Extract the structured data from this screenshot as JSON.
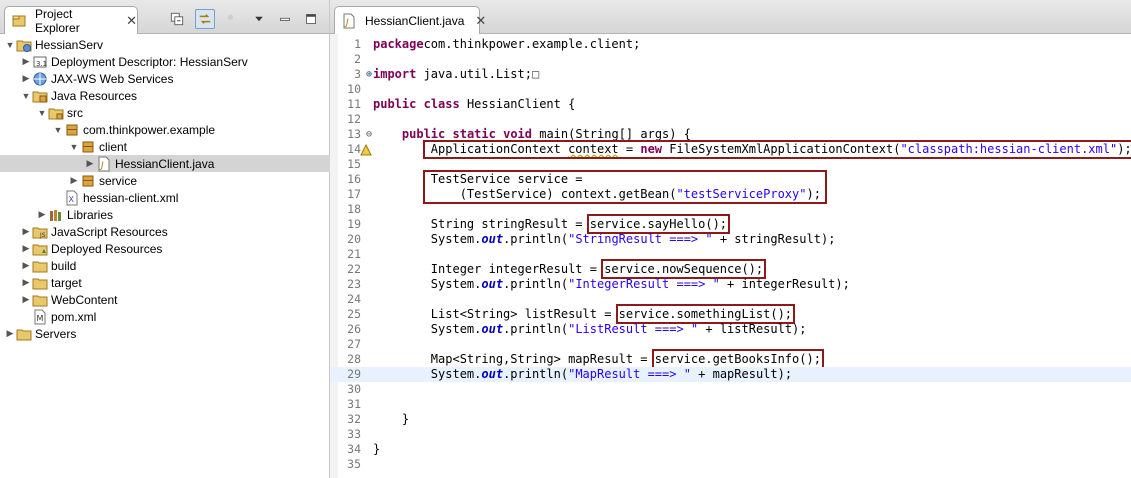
{
  "explorer": {
    "tab_label": "Project Explorer",
    "tab_close": "✕",
    "tree": [
      {
        "label": "HessianServ",
        "depth": 0,
        "twisty": "open",
        "icon": "web-project-icon"
      },
      {
        "label": "Deployment Descriptor: HessianServ",
        "depth": 1,
        "twisty": "closed",
        "icon": "deployment-descriptor-icon"
      },
      {
        "label": "JAX-WS Web Services",
        "depth": 1,
        "twisty": "closed",
        "icon": "web-services-icon"
      },
      {
        "label": "Java Resources",
        "depth": 1,
        "twisty": "open",
        "icon": "java-resources-icon"
      },
      {
        "label": "src",
        "depth": 2,
        "twisty": "open",
        "icon": "source-folder-icon"
      },
      {
        "label": "com.thinkpower.example",
        "depth": 3,
        "twisty": "open",
        "icon": "package-icon"
      },
      {
        "label": "client",
        "depth": 4,
        "twisty": "open",
        "icon": "package-icon"
      },
      {
        "label": "HessianClient.java",
        "depth": 5,
        "twisty": "closed",
        "icon": "java-file-icon",
        "selected": true
      },
      {
        "label": "service",
        "depth": 4,
        "twisty": "closed",
        "icon": "package-icon"
      },
      {
        "label": "hessian-client.xml",
        "depth": 3,
        "twisty": "none",
        "icon": "xml-file-icon"
      },
      {
        "label": "Libraries",
        "depth": 2,
        "twisty": "closed",
        "icon": "libraries-icon"
      },
      {
        "label": "JavaScript Resources",
        "depth": 1,
        "twisty": "closed",
        "icon": "javascript-resources-icon"
      },
      {
        "label": "Deployed Resources",
        "depth": 1,
        "twisty": "closed",
        "icon": "deployed-resources-icon"
      },
      {
        "label": "build",
        "depth": 1,
        "twisty": "closed",
        "icon": "folder-icon"
      },
      {
        "label": "target",
        "depth": 1,
        "twisty": "closed",
        "icon": "folder-icon"
      },
      {
        "label": "WebContent",
        "depth": 1,
        "twisty": "closed",
        "icon": "folder-icon"
      },
      {
        "label": "pom.xml",
        "depth": 1,
        "twisty": "none",
        "icon": "maven-pom-icon"
      },
      {
        "label": "Servers",
        "depth": 0,
        "twisty": "closed",
        "icon": "folder-icon"
      }
    ]
  },
  "editor": {
    "tab_label": "HessianClient.java",
    "tab_close": "✕",
    "lines": [
      {
        "num": "1",
        "tokens": [
          [
            "kw",
            "package"
          ],
          [
            "",
            "com.thinkpower.example.client;"
          ]
        ]
      },
      {
        "num": "2",
        "tokens": []
      },
      {
        "num": "3",
        "marker": "fold-closed",
        "tokens": [
          [
            "kw",
            "import"
          ],
          [
            "",
            " java.util.List;"
          ],
          [
            "box",
            "□"
          ]
        ]
      },
      {
        "num": "10",
        "tokens": []
      },
      {
        "num": "11",
        "tokens": [
          [
            "kw",
            "public"
          ],
          [
            "",
            " "
          ],
          [
            "kw",
            "class"
          ],
          [
            "",
            " HessianClient {"
          ]
        ]
      },
      {
        "num": "12",
        "tokens": []
      },
      {
        "num": "13",
        "marker": "fold-open",
        "tokens": [
          [
            "",
            "    "
          ],
          [
            "kw",
            "public"
          ],
          [
            "",
            " "
          ],
          [
            "kw",
            "static"
          ],
          [
            "",
            " "
          ],
          [
            "kw",
            "void"
          ],
          [
            "",
            " main(String[] args) {"
          ]
        ]
      },
      {
        "num": "14",
        "marker": "warning",
        "tokens": [
          [
            "",
            "        ApplicationContext "
          ],
          [
            "warn",
            "context"
          ],
          [
            "",
            " = "
          ],
          [
            "kw",
            "new"
          ],
          [
            "",
            " FileSystemXmlApplicationContext("
          ],
          [
            "str",
            "\"classpath:hessian-client.xml\""
          ],
          [
            "",
            ");"
          ]
        ]
      },
      {
        "num": "15",
        "tokens": []
      },
      {
        "num": "16",
        "tokens": [
          [
            "",
            "        TestService service ="
          ]
        ]
      },
      {
        "num": "17",
        "tokens": [
          [
            "",
            "            (TestService) context.getBean("
          ],
          [
            "str",
            "\"testServiceProxy\""
          ],
          [
            "",
            ");"
          ]
        ]
      },
      {
        "num": "18",
        "tokens": []
      },
      {
        "num": "19",
        "tokens": [
          [
            "",
            "        String stringResult = "
          ],
          [
            "hl",
            "service.sayHello();"
          ]
        ]
      },
      {
        "num": "20",
        "tokens": [
          [
            "",
            "        System."
          ],
          [
            "st",
            "out"
          ],
          [
            "",
            ".println("
          ],
          [
            "str",
            "\"StringResult ===> \""
          ],
          [
            "",
            " + stringResult);"
          ]
        ]
      },
      {
        "num": "21",
        "tokens": []
      },
      {
        "num": "22",
        "tokens": [
          [
            "",
            "        Integer integerResult = "
          ],
          [
            "hl",
            "service.nowSequence();"
          ]
        ]
      },
      {
        "num": "23",
        "tokens": [
          [
            "",
            "        System."
          ],
          [
            "st",
            "out"
          ],
          [
            "",
            ".println("
          ],
          [
            "str",
            "\"IntegerResult ===> \""
          ],
          [
            "",
            " + integerResult);"
          ]
        ]
      },
      {
        "num": "24",
        "tokens": []
      },
      {
        "num": "25",
        "tokens": [
          [
            "",
            "        List<String> listResult = "
          ],
          [
            "hl",
            "service.somethingList();"
          ]
        ]
      },
      {
        "num": "26",
        "tokens": [
          [
            "",
            "        System."
          ],
          [
            "st",
            "out"
          ],
          [
            "",
            ".println("
          ],
          [
            "str",
            "\"ListResult ===> \""
          ],
          [
            "",
            " + listResult);"
          ]
        ]
      },
      {
        "num": "27",
        "tokens": []
      },
      {
        "num": "28",
        "tokens": [
          [
            "",
            "        Map<String,String> mapResult = "
          ],
          [
            "hl",
            "service.getBooksInfo();"
          ]
        ]
      },
      {
        "num": "29",
        "current": true,
        "tokens": [
          [
            "",
            "        System."
          ],
          [
            "st",
            "out"
          ],
          [
            "",
            ".println("
          ],
          [
            "str",
            "\"MapResult ===> \""
          ],
          [
            "",
            " + mapResult);"
          ]
        ]
      },
      {
        "num": "30",
        "tokens": []
      },
      {
        "num": "31",
        "tokens": []
      },
      {
        "num": "32",
        "tokens": [
          [
            "",
            "    }"
          ]
        ]
      },
      {
        "num": "33",
        "tokens": []
      },
      {
        "num": "34",
        "tokens": [
          [
            "",
            "}"
          ]
        ]
      },
      {
        "num": "35",
        "tokens": []
      }
    ]
  },
  "colors": {
    "keyword": "#7f0055",
    "string": "#2a00ff",
    "static_field": "#0000c0",
    "highlight_box": "#8b1a1a",
    "current_line": "#e8f2fe"
  }
}
